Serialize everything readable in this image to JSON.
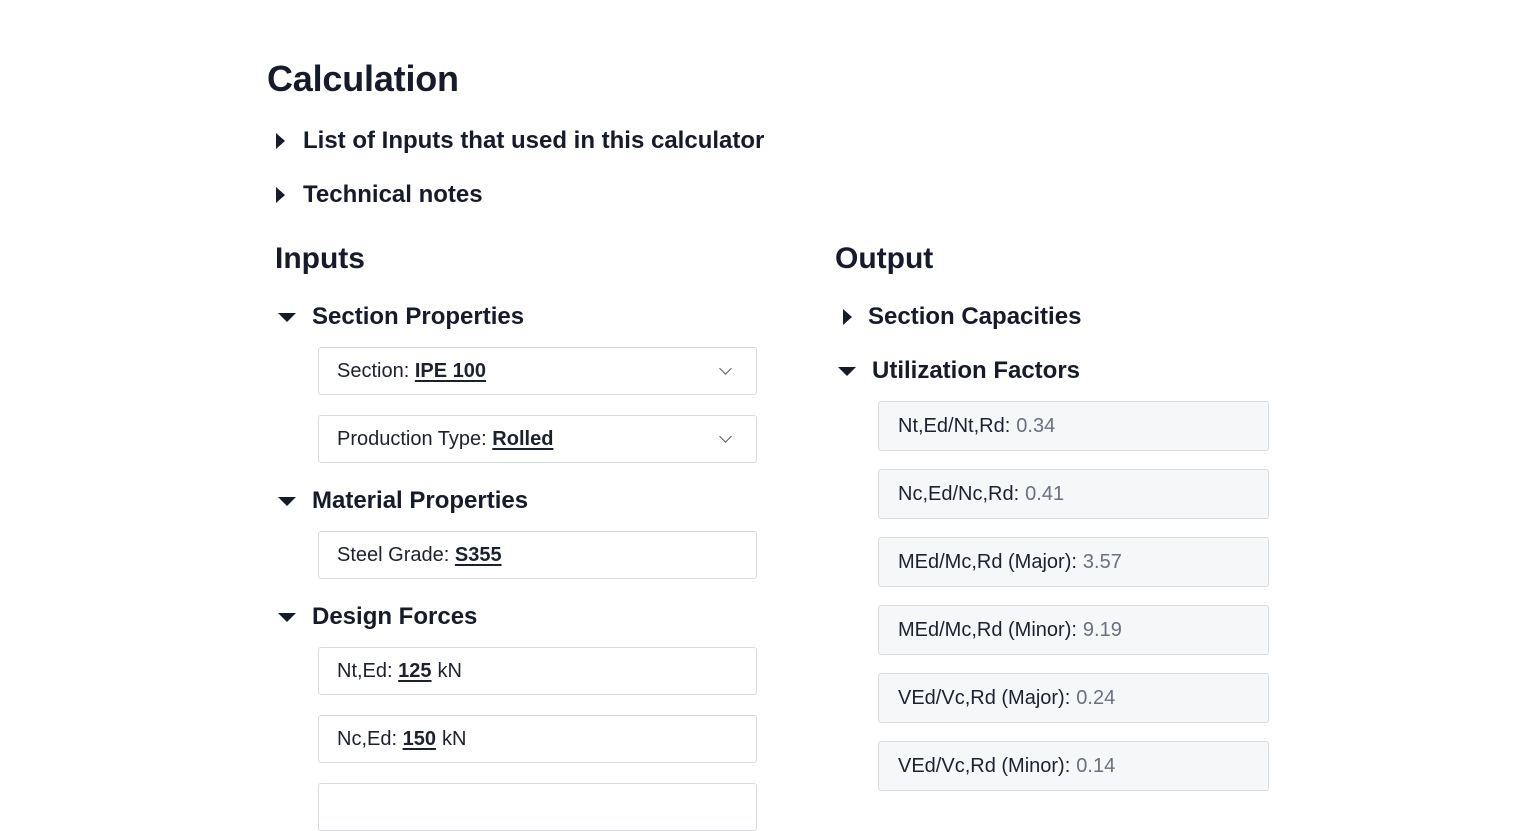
{
  "page": {
    "title": "Calculation"
  },
  "top_sections": [
    {
      "label": "List of Inputs that used in this calculator"
    },
    {
      "label": "Technical notes"
    }
  ],
  "inputs": {
    "title": "Inputs",
    "groups": {
      "section_properties": {
        "label": "Section Properties"
      },
      "material_properties": {
        "label": "Material Properties"
      },
      "design_forces": {
        "label": "Design Forces"
      }
    },
    "section": {
      "label": "Section:",
      "value": "IPE 100"
    },
    "production_type": {
      "label": "Production Type:",
      "value": "Rolled"
    },
    "steel_grade": {
      "label": "Steel Grade:",
      "value": "S355"
    },
    "nt_ed": {
      "label": "Nt,Ed:",
      "value": "125",
      "unit": "kN"
    },
    "nc_ed": {
      "label": "Nc,Ed:",
      "value": "150",
      "unit": "kN"
    }
  },
  "output": {
    "title": "Output",
    "groups": {
      "section_capacities": {
        "label": "Section Capacities"
      },
      "utilization_factors": {
        "label": "Utilization Factors"
      }
    },
    "factors": [
      {
        "label": "Nt,Ed/Nt,Rd:",
        "value": "0.34"
      },
      {
        "label": "Nc,Ed/Nc,Rd:",
        "value": "0.41"
      },
      {
        "label": "MEd/Mc,Rd (Major):",
        "value": "3.57"
      },
      {
        "label": "MEd/Mc,Rd (Minor):",
        "value": "9.19"
      },
      {
        "label": "VEd/Vc,Rd (Major):",
        "value": "0.24"
      },
      {
        "label": "VEd/Vc,Rd (Minor):",
        "value": "0.14"
      }
    ]
  },
  "icons": {
    "collapsed": "caret-right-icon",
    "expanded": "caret-down-icon",
    "dropdown": "chevron-down-icon"
  },
  "colors": {
    "text": "#161b2b",
    "border": "#d7dbe2",
    "output_bg": "#f6f7f9",
    "muted_value": "#6a707d"
  }
}
